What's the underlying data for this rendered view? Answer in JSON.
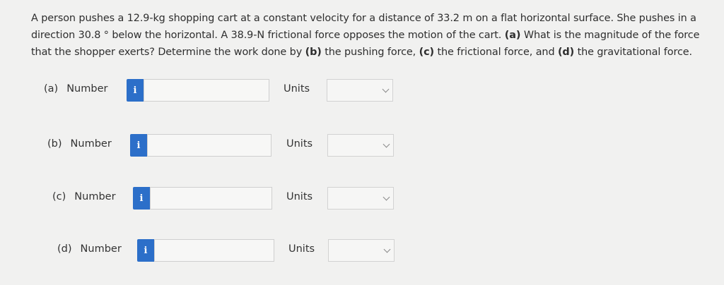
{
  "question": {
    "text_1": "A person pushes a 12.9-kg shopping cart at a constant velocity for a distance of 33.2 m on a flat horizontal surface. She pushes in a direction 30.8 ° below the horizontal. A 38.9-N frictional force opposes the motion of the cart. ",
    "part_a_label": "(a)",
    "text_2": " What is the magnitude of the force that the shopper exerts? Determine the work done by ",
    "part_b_label": "(b)",
    "text_3": " the pushing force, ",
    "part_c_label": "(c)",
    "text_4": " the frictional force, and ",
    "part_d_label": "(d)",
    "text_5": " the gravitational force."
  },
  "parts": [
    {
      "letter": "(a)",
      "label": "Number",
      "info_glyph": "i",
      "value": "",
      "units_label": "Units",
      "units_value": ""
    },
    {
      "letter": "(b)",
      "label": "Number",
      "info_glyph": "i",
      "value": "",
      "units_label": "Units",
      "units_value": ""
    },
    {
      "letter": "(c)",
      "label": "Number",
      "info_glyph": "i",
      "value": "",
      "units_label": "Units",
      "units_value": ""
    },
    {
      "letter": "(d)",
      "label": "Number",
      "info_glyph": "i",
      "value": "",
      "units_label": "Units",
      "units_value": ""
    }
  ],
  "icons": {
    "info": "info-icon",
    "dropdown": "chevron-down-icon"
  },
  "colors": {
    "accent": "#2c6fc9",
    "background": "#f1f1f0"
  }
}
